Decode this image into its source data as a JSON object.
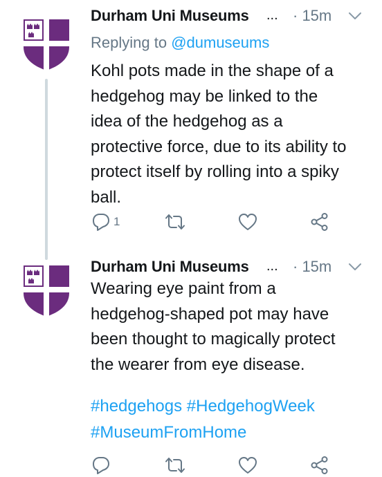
{
  "colors": {
    "text": "#14171a",
    "secondary": "#657786",
    "link": "#1da1f2",
    "thread_line": "#cfd9de",
    "avatar_purple": "#6b2c7e"
  },
  "tweets": [
    {
      "author": "Durham Uni Museums",
      "ellipsis": "...",
      "time": "· 15m",
      "replying_prefix": "Replying to ",
      "replying_handle": "@dumuseums",
      "lines": [
        "Kohl pots made in the shape of a",
        "hedgehog may be linked to the",
        "idea of the hedgehog as a",
        "protective force, due to its ability to",
        "protect itself by rolling into a spiky",
        "ball."
      ],
      "reply_count": "1",
      "icons": [
        "reply-icon",
        "retweet-icon",
        "like-icon",
        "share-icon"
      ]
    },
    {
      "author": "Durham Uni Museums",
      "ellipsis": "...",
      "time": "· 15m",
      "lines": [
        "Wearing eye paint from a",
        "hedgehog-shaped pot may have",
        "been thought to magically protect",
        "the wearer from eye disease."
      ],
      "hashtag_lines": [
        "#hedgehogs #HedgehogWeek",
        "#MuseumFromHome"
      ],
      "icons": [
        "reply-icon",
        "retweet-icon",
        "like-icon",
        "share-icon"
      ]
    }
  ]
}
